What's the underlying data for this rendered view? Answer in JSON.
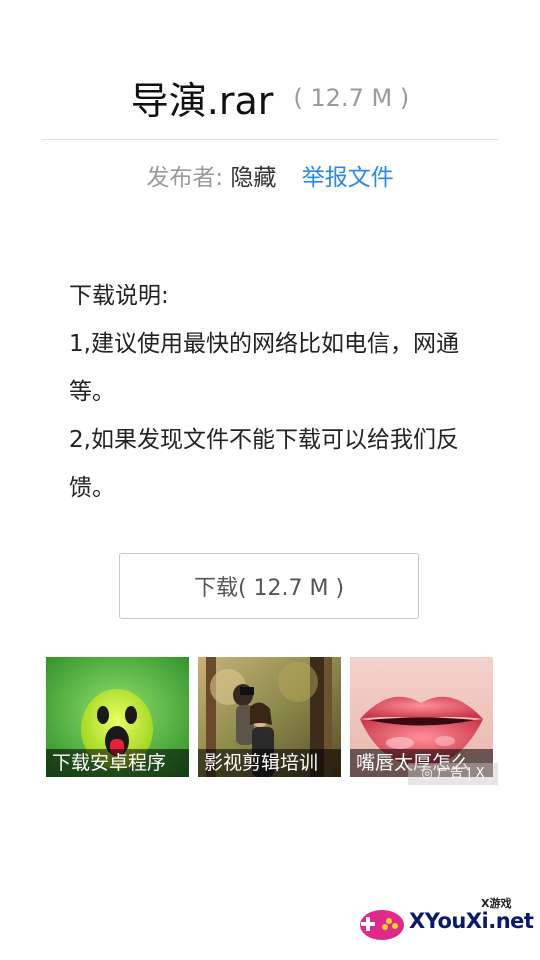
{
  "file": {
    "name": "导演.rar",
    "size": "( 12.7 M )"
  },
  "meta": {
    "publisher_label": "发布者:",
    "publisher_value": "隐藏",
    "report_link": "举报文件"
  },
  "description": {
    "heading": "下载说明:",
    "line1": "1,建议使用最快的网络比如电信，网通等。",
    "line2": "2,如果发现文件不能下载可以给我们反馈。"
  },
  "download_button": "下载( 12.7 M )",
  "ads": [
    {
      "caption": "下载安卓程序",
      "icon": "android-mascot-image"
    },
    {
      "caption": "影视剪辑培训",
      "icon": "camera-woman-photo"
    },
    {
      "caption": "嘴唇太厚怎么",
      "icon": "lips-photo"
    }
  ],
  "ad_close_label": "◎ 广告 | X",
  "watermark": {
    "small_text": "X游戏",
    "brand_text": "XYouXi.net"
  },
  "colors": {
    "link": "#2a8ae0",
    "muted": "#9a9a9a"
  }
}
